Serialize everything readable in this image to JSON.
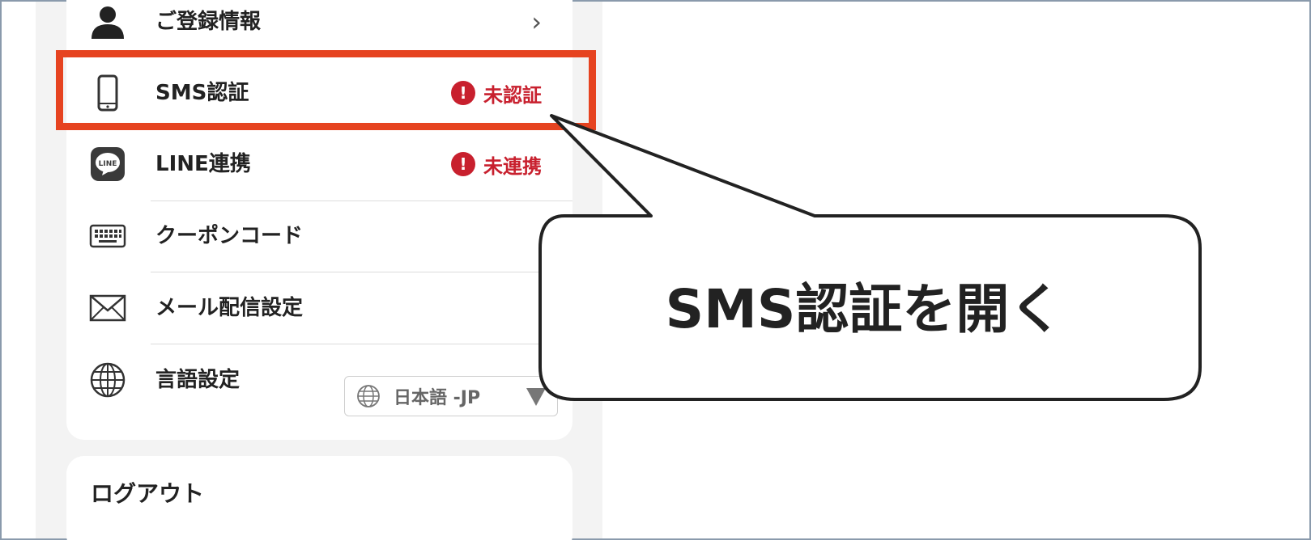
{
  "menu": {
    "items": [
      {
        "label": "ご登録情報",
        "icon": "person-icon"
      },
      {
        "label": "SMS認証",
        "icon": "smartphone-icon",
        "status": "未認証"
      },
      {
        "label": "LINE連携",
        "icon": "line-icon",
        "status": "未連携",
        "icon_text": "LINE"
      },
      {
        "label": "クーポンコード",
        "icon": "keyboard-icon"
      },
      {
        "label": "メール配信設定",
        "icon": "envelope-icon"
      },
      {
        "label": "言語設定",
        "icon": "globe-icon"
      }
    ],
    "language_select": {
      "value": "日本語 -JP"
    },
    "status_mark": "!",
    "chevron": "›"
  },
  "logout": {
    "label": "ログアウト"
  },
  "callout": {
    "text": "SMS認証を開く"
  },
  "colors": {
    "highlight": "#e64320",
    "status_red": "#c8202e",
    "panel_bg": "#f3f3f3"
  }
}
